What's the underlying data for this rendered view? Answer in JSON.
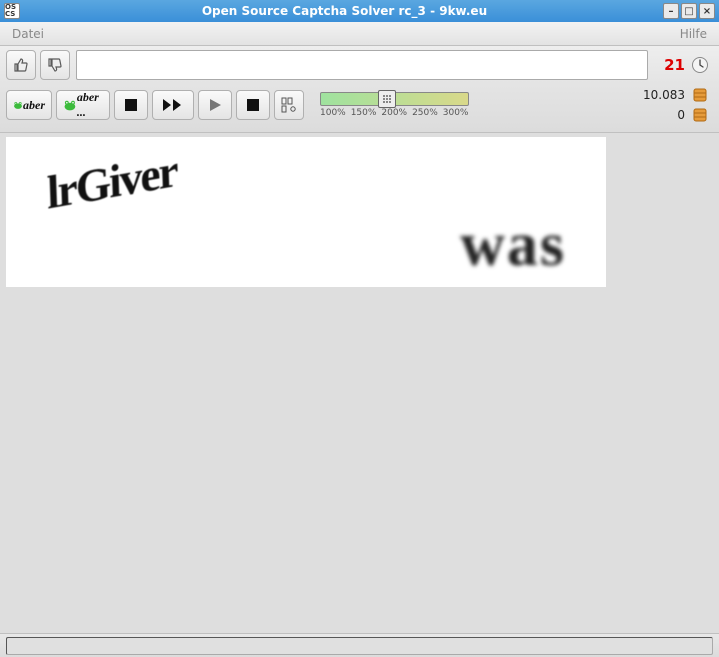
{
  "window": {
    "title": "Open Source Captcha Solver rc_3 - 9kw.eu",
    "app_icon_text": "OS\nCS"
  },
  "menubar": {
    "file": "Datei",
    "help": "Hilfe"
  },
  "toolbar": {
    "input_value": "",
    "input_placeholder": ""
  },
  "stats": {
    "timer": "21",
    "score": "10.083",
    "coins": "0"
  },
  "zoom": {
    "labels": [
      "100%",
      "150%",
      "200%",
      "250%",
      "300%"
    ],
    "thumb_percent": 45
  },
  "captcha": {
    "word1": "lrGiver",
    "word2": "was"
  },
  "icons": {
    "thumbs_up": "thumbs-up-icon",
    "thumbs_down": "thumbs-down-icon",
    "frog1": "frog-icon",
    "frog2": "frog-ellipsis-icon",
    "stop1": "stop-icon",
    "ffwd": "fast-forward-icon",
    "play": "play-icon",
    "stop2": "stop-icon",
    "columns": "columns-icon",
    "clock": "clock-icon",
    "cookie": "cookie-icon"
  },
  "status": {
    "text": ""
  }
}
